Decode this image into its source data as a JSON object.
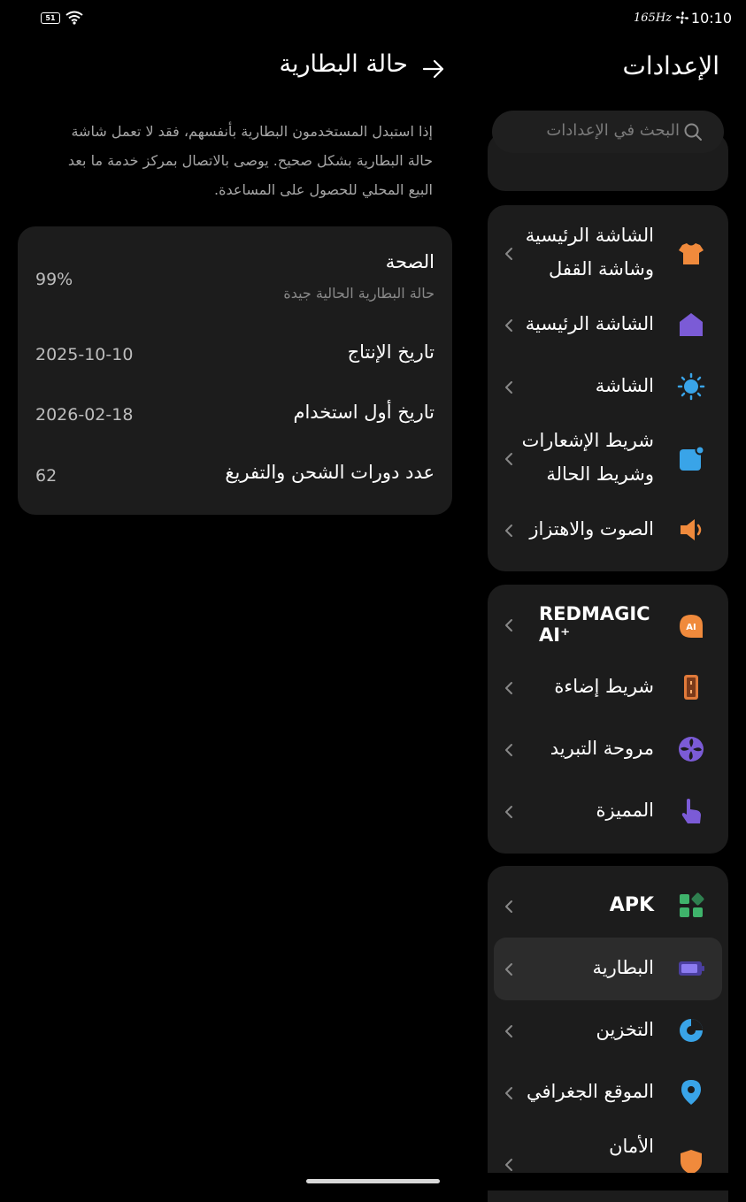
{
  "status_bar": {
    "battery_level": "51",
    "refresh_rate": "165Hz",
    "time": "10:10"
  },
  "settings": {
    "title": "الإعدادات",
    "search_placeholder": "البحث في الإعدادات",
    "group1": [
      {
        "label": "الشاشة الرئيسية وشاشة القفل",
        "icon": "shirt-icon",
        "color": "#f08a3c"
      },
      {
        "label": "الشاشة الرئيسية",
        "icon": "home-icon",
        "color": "#7b5bd6"
      },
      {
        "label": "الشاشة",
        "icon": "sun-icon",
        "color": "#39a4e8"
      },
      {
        "label": "شريط الإشعارات وشريط الحالة",
        "icon": "notification-icon",
        "color": "#39a4e8"
      },
      {
        "label": "الصوت والاهتزاز",
        "icon": "speaker-icon",
        "color": "#f08a3c"
      }
    ],
    "group2": [
      {
        "label": "REDMAGIC AI⁺",
        "icon": "ai-icon",
        "color": "#f08a3c"
      },
      {
        "label": "شريط إضاءة",
        "icon": "light-strip-icon",
        "color": "#e07a3a"
      },
      {
        "label": "مروحة التبريد",
        "icon": "fan-icon",
        "color": "#7b5bd6"
      },
      {
        "label": "المميزة",
        "icon": "hand-pointer-icon",
        "color": "#7b5bd6"
      }
    ],
    "group3": [
      {
        "label": "APK",
        "icon": "apps-icon",
        "color": "#3fb36b"
      },
      {
        "label": "البطارية",
        "icon": "battery-icon",
        "color": "#8b7bf0"
      },
      {
        "label": "التخزين",
        "icon": "storage-icon",
        "color": "#39a4e8"
      },
      {
        "label": "الموقع الجغرافي",
        "icon": "location-icon",
        "color": "#39a4e8"
      },
      {
        "label": "الأمان",
        "icon": "shield-icon",
        "color": "#f08a3c"
      }
    ]
  },
  "battery_status": {
    "title": "حالة البطارية",
    "description": "إذا استبدل المستخدمون البطارية بأنفسهم، فقد لا تعمل شاشة حالة البطارية بشكل صحيح. يوصى بالاتصال بمركز خدمة ما بعد البيع المحلي للحصول على المساعدة.",
    "health_label": "الصحة",
    "health_sub": "حالة البطارية الحالية جيدة",
    "health_value": "99%",
    "manufacture_label": "تاريخ الإنتاج",
    "manufacture_value": "2025-10-10",
    "first_use_label": "تاريخ أول استخدام",
    "first_use_value": "2026-02-18",
    "cycles_label": "عدد دورات الشحن والتفريغ",
    "cycles_value": "62"
  }
}
